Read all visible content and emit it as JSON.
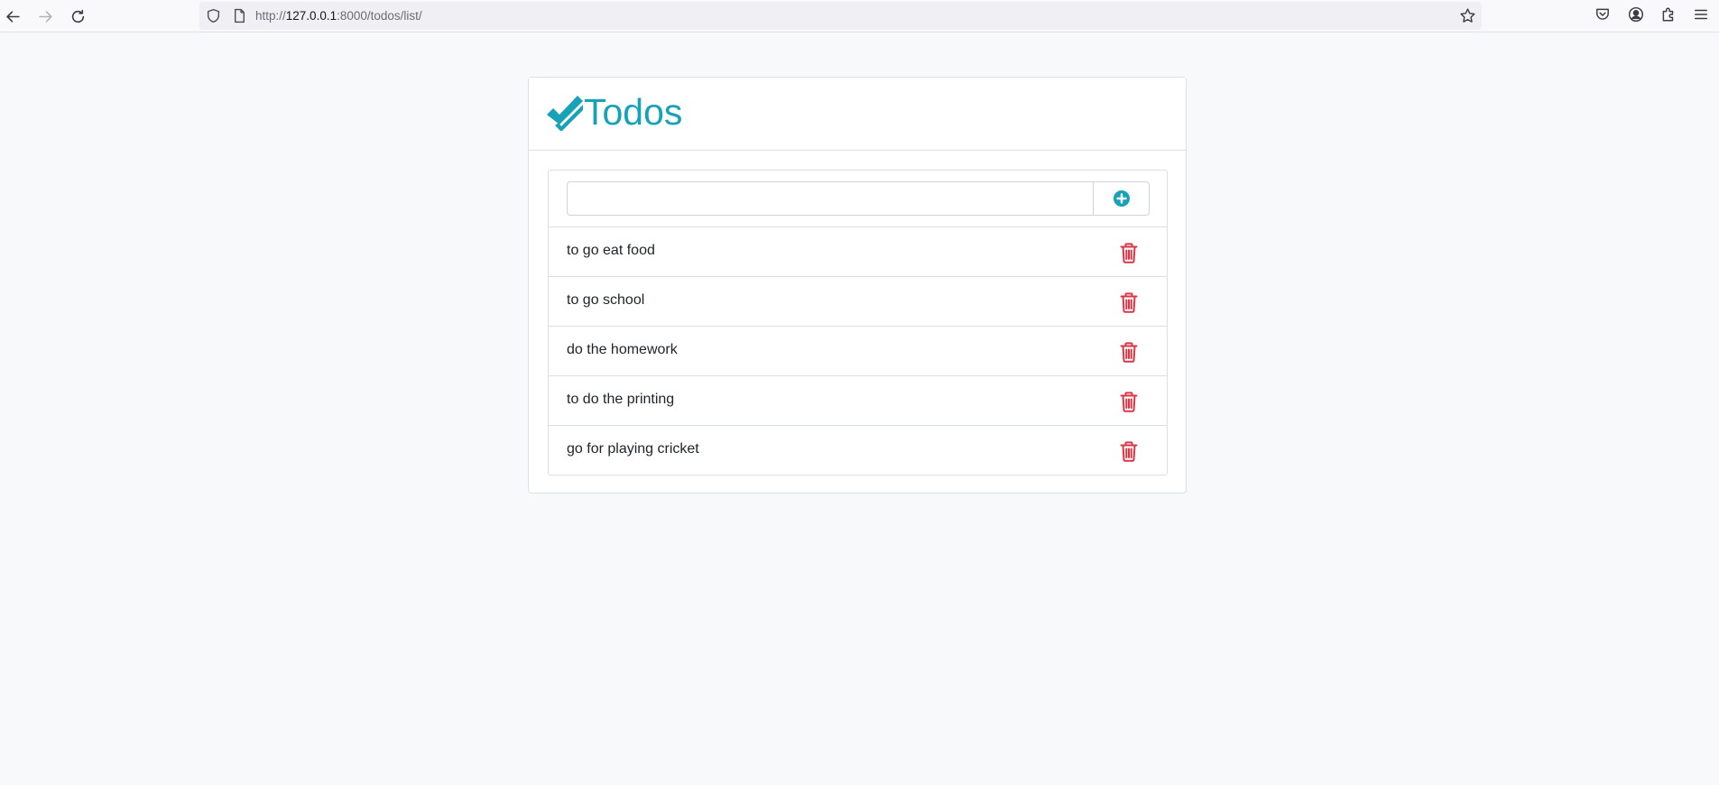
{
  "browser": {
    "url_prefix": "http://",
    "url_host": "127.0.0.1",
    "url_rest": ":8000/todos/list/"
  },
  "header": {
    "title": "Todos",
    "icon": "check-double-icon",
    "accent_color": "#17a2b8"
  },
  "form": {
    "input_value": "",
    "add_icon": "plus-circle-icon"
  },
  "todos": [
    {
      "text": "to go eat food"
    },
    {
      "text": "to go school"
    },
    {
      "text": "do the homework"
    },
    {
      "text": "to do the printing"
    },
    {
      "text": "go for playing cricket"
    }
  ],
  "delete_icon": "trash-icon",
  "delete_color": "#dc3545"
}
